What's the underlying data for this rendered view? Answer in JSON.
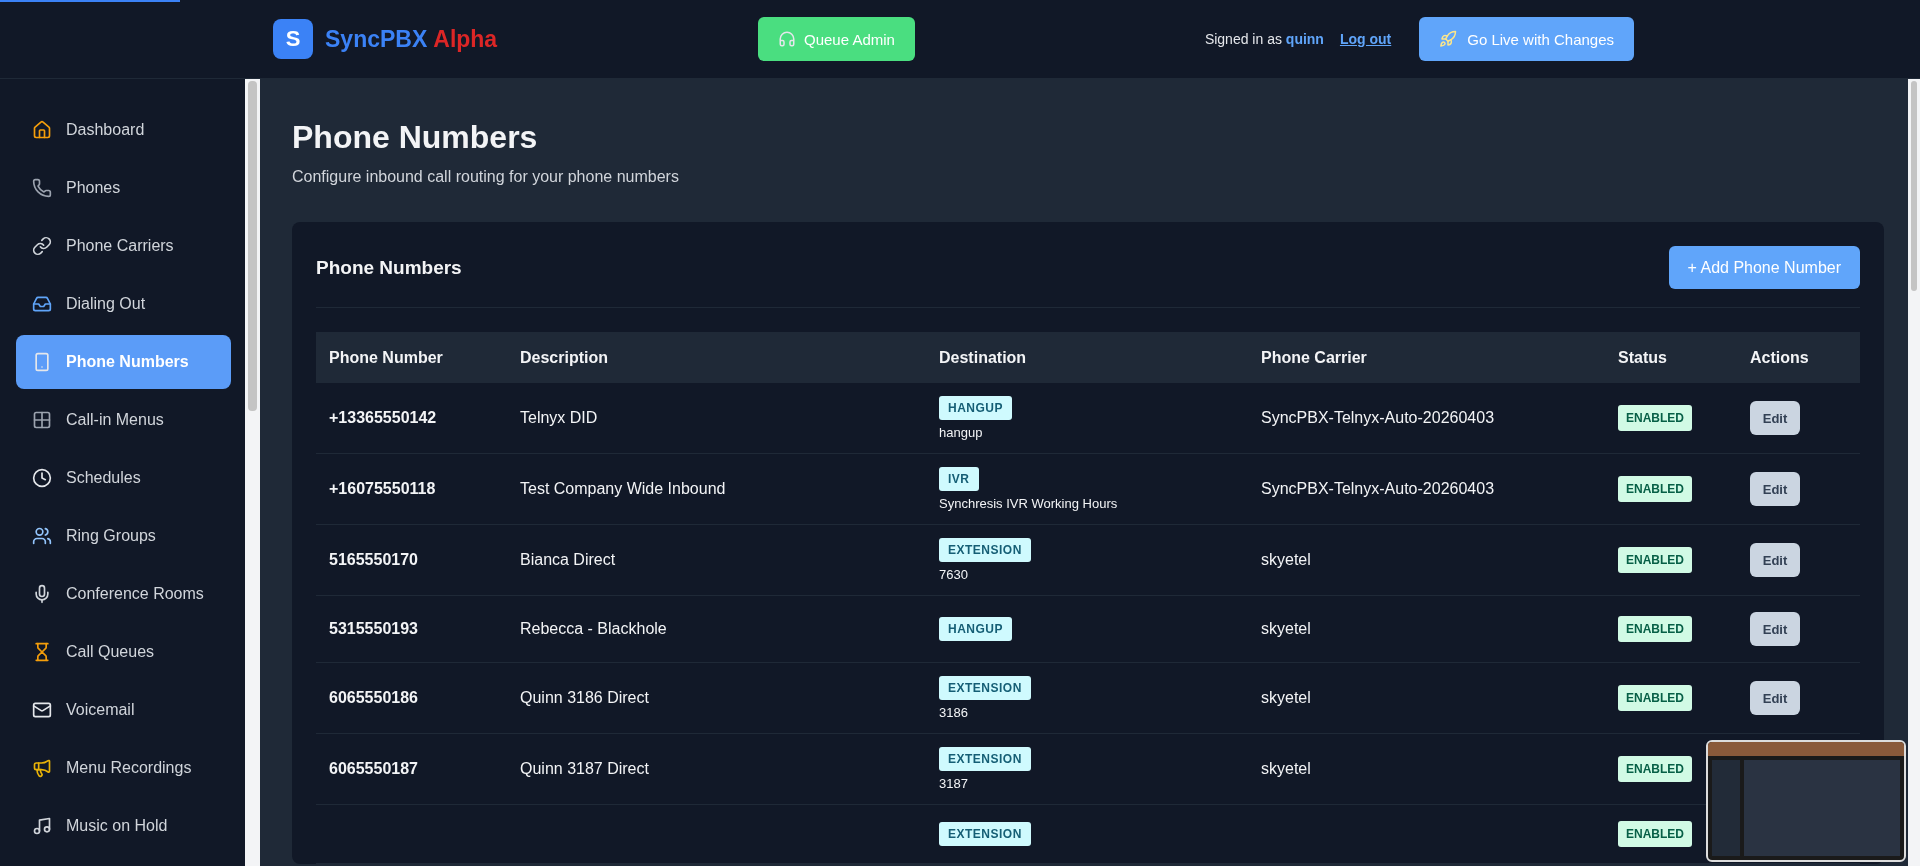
{
  "header": {
    "logo_letter": "S",
    "brand": "SyncPBX",
    "brand_suffix": "Alpha",
    "queue_button": "Queue Admin",
    "signed_in_label": "Signed in as",
    "user": "quinn",
    "logout": "Log out",
    "publish_button": "Go Live with Changes"
  },
  "sidebar": {
    "items": [
      {
        "label": "Dashboard",
        "selected": false
      },
      {
        "label": "Phones",
        "selected": false
      },
      {
        "label": "Phone Carriers",
        "selected": false
      },
      {
        "label": "Dialing Out",
        "selected": false
      },
      {
        "label": "Phone Numbers",
        "selected": true
      },
      {
        "label": "Call-in Menus",
        "selected": false
      },
      {
        "label": "Schedules",
        "selected": false
      },
      {
        "label": "Ring Groups",
        "selected": false
      },
      {
        "label": "Conference Rooms",
        "selected": false
      },
      {
        "label": "Call Queues",
        "selected": false
      },
      {
        "label": "Voicemail",
        "selected": false
      },
      {
        "label": "Menu Recordings",
        "selected": false
      },
      {
        "label": "Music on Hold",
        "selected": false
      }
    ]
  },
  "page": {
    "title": "Phone Numbers",
    "subtitle": "Configure inbound call routing for your phone numbers"
  },
  "card": {
    "title": "Phone Numbers",
    "add_button": "+ Add Phone Number",
    "table": {
      "columns": [
        "Phone Number",
        "Description",
        "Destination",
        "Phone Carrier",
        "Status",
        "Actions"
      ],
      "rows": [
        {
          "phone_number": "+13365550142",
          "description": "Telnyx DID",
          "destination": {
            "type": "HANGUP",
            "detail": "hangup"
          },
          "carrier": "SyncPBX-Telnyx-Auto-20260403",
          "status": "ENABLED",
          "action": "Edit"
        },
        {
          "phone_number": "+16075550118",
          "description": "Test Company Wide Inbound",
          "destination": {
            "type": "IVR",
            "detail": "Synchresis IVR Working Hours"
          },
          "carrier": "SyncPBX-Telnyx-Auto-20260403",
          "status": "ENABLED",
          "action": "Edit"
        },
        {
          "phone_number": "5165550170",
          "description": "Bianca Direct",
          "destination": {
            "type": "EXTENSION",
            "detail": "7630"
          },
          "carrier": "skyetel",
          "status": "ENABLED",
          "action": "Edit"
        },
        {
          "phone_number": "5315550193",
          "description": "Rebecca - Blackhole",
          "destination": {
            "type": "HANGUP"
          },
          "carrier": "skyetel",
          "status": "ENABLED",
          "action": "Edit"
        },
        {
          "phone_number": "6065550186",
          "description": "Quinn 3186 Direct",
          "destination": {
            "type": "EXTENSION",
            "detail": "3186"
          },
          "carrier": "skyetel",
          "status": "ENABLED",
          "action": "Edit"
        },
        {
          "phone_number": "6065550187",
          "description": "Quinn 3187 Direct",
          "destination": {
            "type": "EXTENSION",
            "detail": "3187"
          },
          "carrier": "skyetel",
          "status": "ENABLED"
        },
        {
          "destination": {
            "type": "EXTENSION"
          },
          "status": "ENABLED"
        }
      ]
    }
  }
}
